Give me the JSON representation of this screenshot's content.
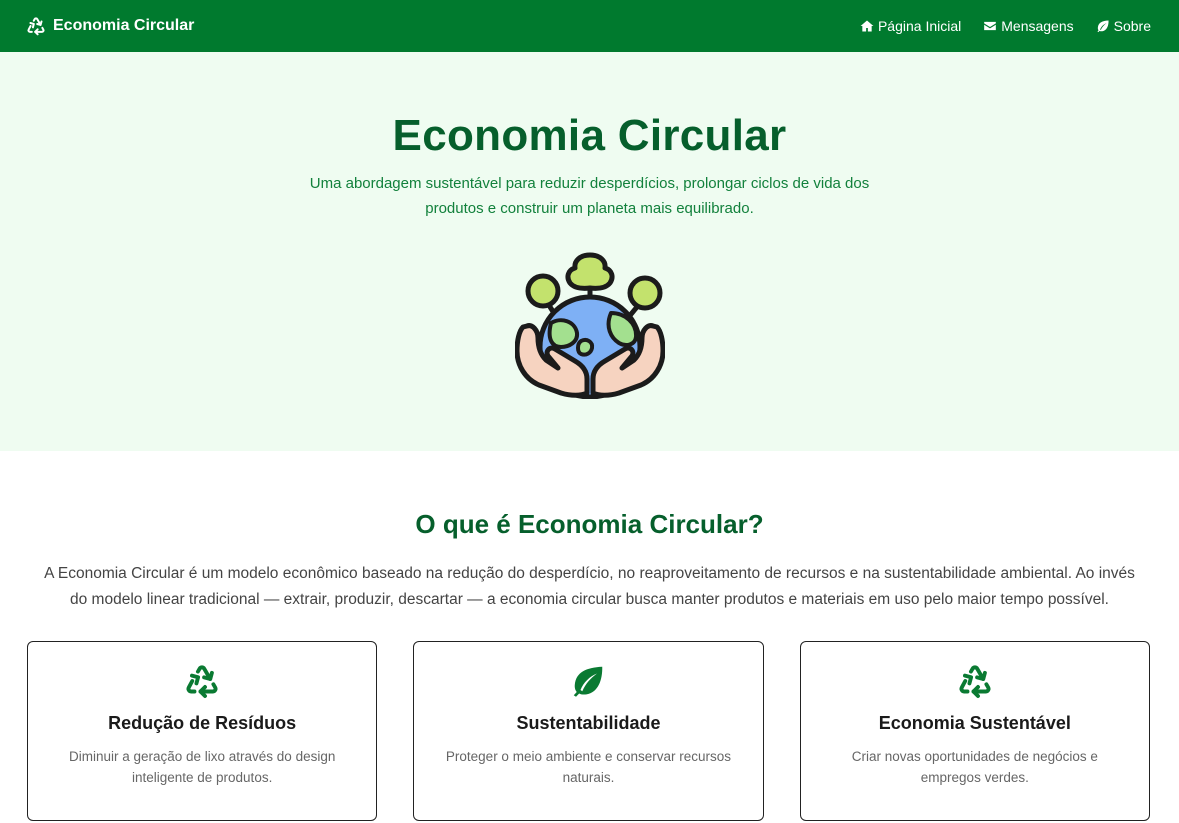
{
  "navbar": {
    "brand_icon": "recycle-icon",
    "brand": "Economia Circular",
    "links": [
      {
        "icon": "home-icon",
        "label": "Página Inicial"
      },
      {
        "icon": "envelope-icon",
        "label": "Mensagens"
      },
      {
        "icon": "leaf-icon",
        "label": "Sobre"
      }
    ]
  },
  "hero": {
    "title": "Economia Circular",
    "subtitle": "Uma abordagem sustentável para reduzir desperdícios, prolongar ciclos de vida dos produtos e construir um planeta mais equilibrado.",
    "image": "earth-in-hands-illustration"
  },
  "about": {
    "title": "O que é Economia Circular?",
    "text": "A Economia Circular é um modelo econômico baseado na redução do desperdício, no reaproveitamento de recursos e na sustentabilidade ambiental. Ao invés do modelo linear tradicional — extrair, produzir, descartar — a economia circular busca manter produtos e materiais em uso pelo maior tempo possível."
  },
  "cards": [
    {
      "icon": "recycle-icon",
      "title": "Redução de Resíduos",
      "text": "Diminuir a geração de lixo através do design inteligente de produtos."
    },
    {
      "icon": "leaf-icon",
      "title": "Sustentabilidade",
      "text": "Proteger o meio ambiente e conservar recursos naturais."
    },
    {
      "icon": "recycle-icon",
      "title": "Economia Sustentável",
      "text": "Criar novas oportunidades de negócios e empregos verdes."
    }
  ],
  "colors": {
    "primary": "#007a2e",
    "hero_bg": "#effcf1",
    "heading": "#065f2c"
  }
}
